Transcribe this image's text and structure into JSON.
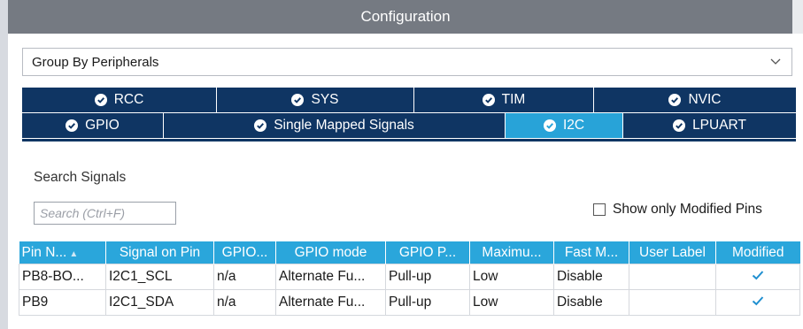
{
  "window": {
    "title": "Configuration"
  },
  "group_by": {
    "selected": "Group By Peripherals"
  },
  "tabs": {
    "row1": [
      {
        "label": "RCC",
        "icon": "check-circle-icon"
      },
      {
        "label": "SYS",
        "icon": "check-circle-icon"
      },
      {
        "label": "TIM",
        "icon": "check-circle-icon"
      },
      {
        "label": "NVIC",
        "icon": "check-circle-icon"
      }
    ],
    "row2": [
      {
        "label": "GPIO",
        "icon": "check-circle-icon"
      },
      {
        "label": "Single Mapped Signals",
        "icon": "check-circle-icon"
      },
      {
        "label": "I2C",
        "icon": "check-circle-icon",
        "active": true
      },
      {
        "label": "LPUART",
        "icon": "check-circle-icon"
      }
    ]
  },
  "search": {
    "label": "Search Signals",
    "placeholder": "Search (Ctrl+F)"
  },
  "filter": {
    "show_only_modified_label": "Show only Modified Pins",
    "checked": false
  },
  "table": {
    "headers": [
      "Pin N...",
      "Signal on Pin",
      "GPIO...",
      "GPIO mode",
      "GPIO P...",
      "Maximu...",
      "Fast M...",
      "User Label",
      "Modified"
    ],
    "rows": [
      {
        "pin": "PB8-BO...",
        "signal": "I2C1_SCL",
        "gpio": "n/a",
        "mode": "Alternate Fu...",
        "pull": "Pull-up",
        "max": "Low",
        "fast": "Disable",
        "label": "",
        "modified": true
      },
      {
        "pin": "PB9",
        "signal": "I2C1_SDA",
        "gpio": "n/a",
        "mode": "Alternate Fu...",
        "pull": "Pull-up",
        "max": "Low",
        "fast": "Disable",
        "label": "",
        "modified": true
      }
    ]
  },
  "colors": {
    "tab_bar": "#0f3563",
    "tab_active": "#28a3d8",
    "table_header": "#2aa6db",
    "title_bar": "#757a82",
    "checkmark": "#1f8fd0"
  }
}
